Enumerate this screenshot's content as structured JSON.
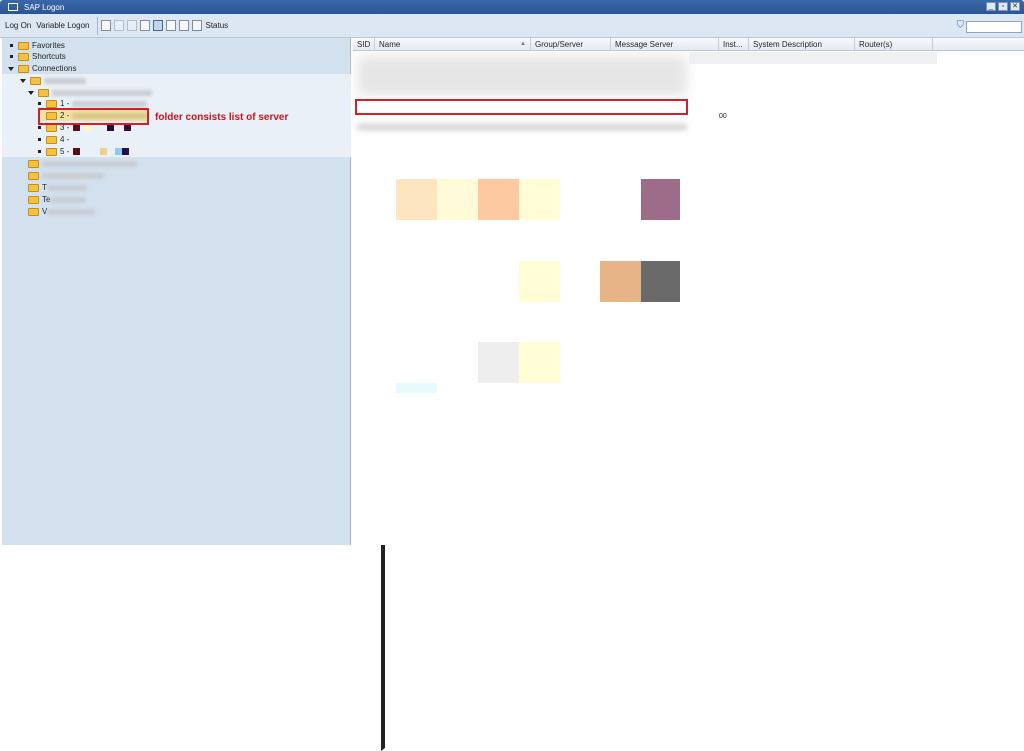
{
  "window": {
    "title": "SAP Logon",
    "controls": [
      "minimize",
      "restore",
      "close"
    ]
  },
  "toolbar": {
    "log_on": "Log On",
    "variable_logon": "Variable Logon",
    "status": "Status"
  },
  "tree": {
    "favorites": "Favorites",
    "shortcuts": "Shortcuts",
    "connections": "Connections",
    "sub_items": [
      {
        "label": "1 -"
      },
      {
        "label": "2 -"
      },
      {
        "label": "3 -"
      },
      {
        "label": "4 -"
      },
      {
        "label": "5 -"
      }
    ],
    "groups": [
      {
        "label": "T"
      },
      {
        "label": "T"
      },
      {
        "label": "T"
      },
      {
        "label": "Te"
      },
      {
        "label": "V"
      }
    ]
  },
  "annotation": "folder consists list of server",
  "table": {
    "columns": [
      "SID",
      "Name",
      "Group/Server",
      "Message Server",
      "Inst...",
      "System Description",
      "Router(s)"
    ],
    "instance_value": "00"
  },
  "colors": {
    "title_bar": "#2b5596",
    "highlight": "#d41f2a",
    "tree_bg": "#d3e1ef"
  }
}
